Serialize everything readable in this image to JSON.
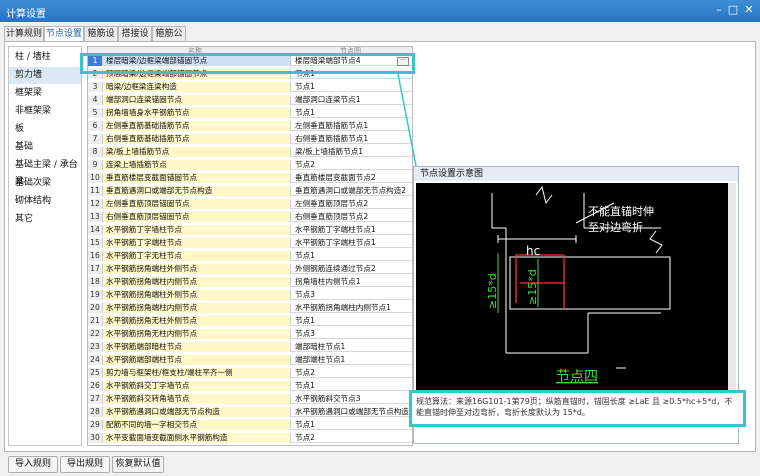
{
  "window": {
    "title": "计算设置"
  },
  "tabs": [
    "计算规则",
    "节点设置",
    "箍筋设置",
    "搭接设置",
    "箍筋公式"
  ],
  "categories": [
    "柱 / 墙柱",
    "剪力墙",
    "框架梁",
    "非框架梁",
    "板",
    "基础",
    "基础主梁 / 承台梁",
    "基础次梁",
    "砌体结构",
    "其它"
  ],
  "grid": {
    "header_name": "名称",
    "header_value": "节点图",
    "rows": [
      {
        "n": "1",
        "name": "楼层暗梁/边框梁端部锚固节点",
        "value": "楼层暗梁端部节点4"
      },
      {
        "n": "2",
        "name": "顶层暗梁/边框梁端部锚固节点",
        "value": "节点1"
      },
      {
        "n": "3",
        "name": "暗梁/边框梁连梁构造",
        "value": "节点1"
      },
      {
        "n": "4",
        "name": "端部洞口连梁锚固节点",
        "value": "端部洞口连梁节点1"
      },
      {
        "n": "5",
        "name": "拐角墙墙身水平钢筋节点",
        "value": "节点1"
      },
      {
        "n": "6",
        "name": "左侧垂直筋基础插筋节点",
        "value": "左侧垂直筋插筋节点1"
      },
      {
        "n": "7",
        "name": "右侧垂直筋基础插筋节点",
        "value": "右侧垂直筋插筋节点1"
      },
      {
        "n": "8",
        "name": "梁/板上墙插筋节点",
        "value": "梁/板上墙插筋节点1"
      },
      {
        "n": "9",
        "name": "连梁上墙插筋节点",
        "value": "节点2"
      },
      {
        "n": "10",
        "name": "垂直筋楼层变截面锚固节点",
        "value": "垂直筋楼层变截面节点2"
      },
      {
        "n": "11",
        "name": "垂直筋遇洞口或端部无节点构造",
        "value": "垂直筋遇洞口或端部无节点构造2"
      },
      {
        "n": "12",
        "name": "左侧垂直筋顶层锚固节点",
        "value": "左侧垂直筋顶层节点2"
      },
      {
        "n": "13",
        "name": "右侧垂直筋顶层锚固节点",
        "value": "右侧垂直筋顶层节点2"
      },
      {
        "n": "14",
        "name": "水平钢筋丁字墙柱节点",
        "value": "水平钢筋丁字端柱节点1"
      },
      {
        "n": "15",
        "name": "水平钢筋丁字端柱节点",
        "value": "水平钢筋丁字端柱节点1"
      },
      {
        "n": "16",
        "name": "水平钢筋丁字无柱节点",
        "value": "节点1"
      },
      {
        "n": "17",
        "name": "水平钢筋拐角端柱外侧节点",
        "value": "外侧钢筋连续通过节点2"
      },
      {
        "n": "18",
        "name": "水平钢筋拐角端柱内侧节点",
        "value": "拐角墙柱内侧节点1"
      },
      {
        "n": "19",
        "name": "水平钢筋拐角端柱外侧节点",
        "value": "节点3"
      },
      {
        "n": "20",
        "name": "水平钢筋拐角端柱内侧节点",
        "value": "水平钢筋拐角端柱内侧节点1"
      },
      {
        "n": "21",
        "name": "水平钢筋拐角无柱外侧节点",
        "value": "节点1"
      },
      {
        "n": "22",
        "name": "水平钢筋拐角无柱内侧节点",
        "value": "节点3"
      },
      {
        "n": "23",
        "name": "水平钢筋端部暗柱节点",
        "value": "端部暗柱节点1"
      },
      {
        "n": "24",
        "name": "水平钢筋端部端柱节点",
        "value": "端部端柱节点1"
      },
      {
        "n": "25",
        "name": "剪力墙与框架柱/框支柱/端柱平齐一侧",
        "value": "节点2"
      },
      {
        "n": "26",
        "name": "水平钢筋斜交丁字墙节点",
        "value": "节点1"
      },
      {
        "n": "27",
        "name": "水平钢筋斜交转角墙节点",
        "value": "水平钢筋斜交节点3"
      },
      {
        "n": "28",
        "name": "水平钢筋遇洞口或端部无节点构造",
        "value": "水平钢筋遇洞口或端部无节点构造2"
      },
      {
        "n": "29",
        "name": "配筋不同的墙一字相交节点",
        "value": "节点1"
      },
      {
        "n": "30",
        "name": "水平变截面墙变截面侧水平钢筋构造",
        "value": "节点2"
      }
    ]
  },
  "preview": {
    "title": "节点设置示意图",
    "texts": {
      "note_line1": "不能直锚时伸",
      "note_line2": "至对边弯折",
      "hc": "hc",
      "dim_outer": "≥15*d",
      "dim_inner": "≥15*d",
      "node_label": "节点四"
    },
    "description": "规范算法：来源16G101-1第79页；纵筋直锚时，锚固长度 ≥LaE 且 ≥0.5*hc+5*d，不能直锚时伸至对边弯折，弯折长度默认为 15*d。"
  },
  "buttons": {
    "import": "导入规则",
    "export": "导出规则",
    "restore": "恢复默认值"
  },
  "colors": {
    "highlight": "#35c6cc",
    "title_bar": "#2a74c0",
    "name_cell": "#fff8c8"
  }
}
